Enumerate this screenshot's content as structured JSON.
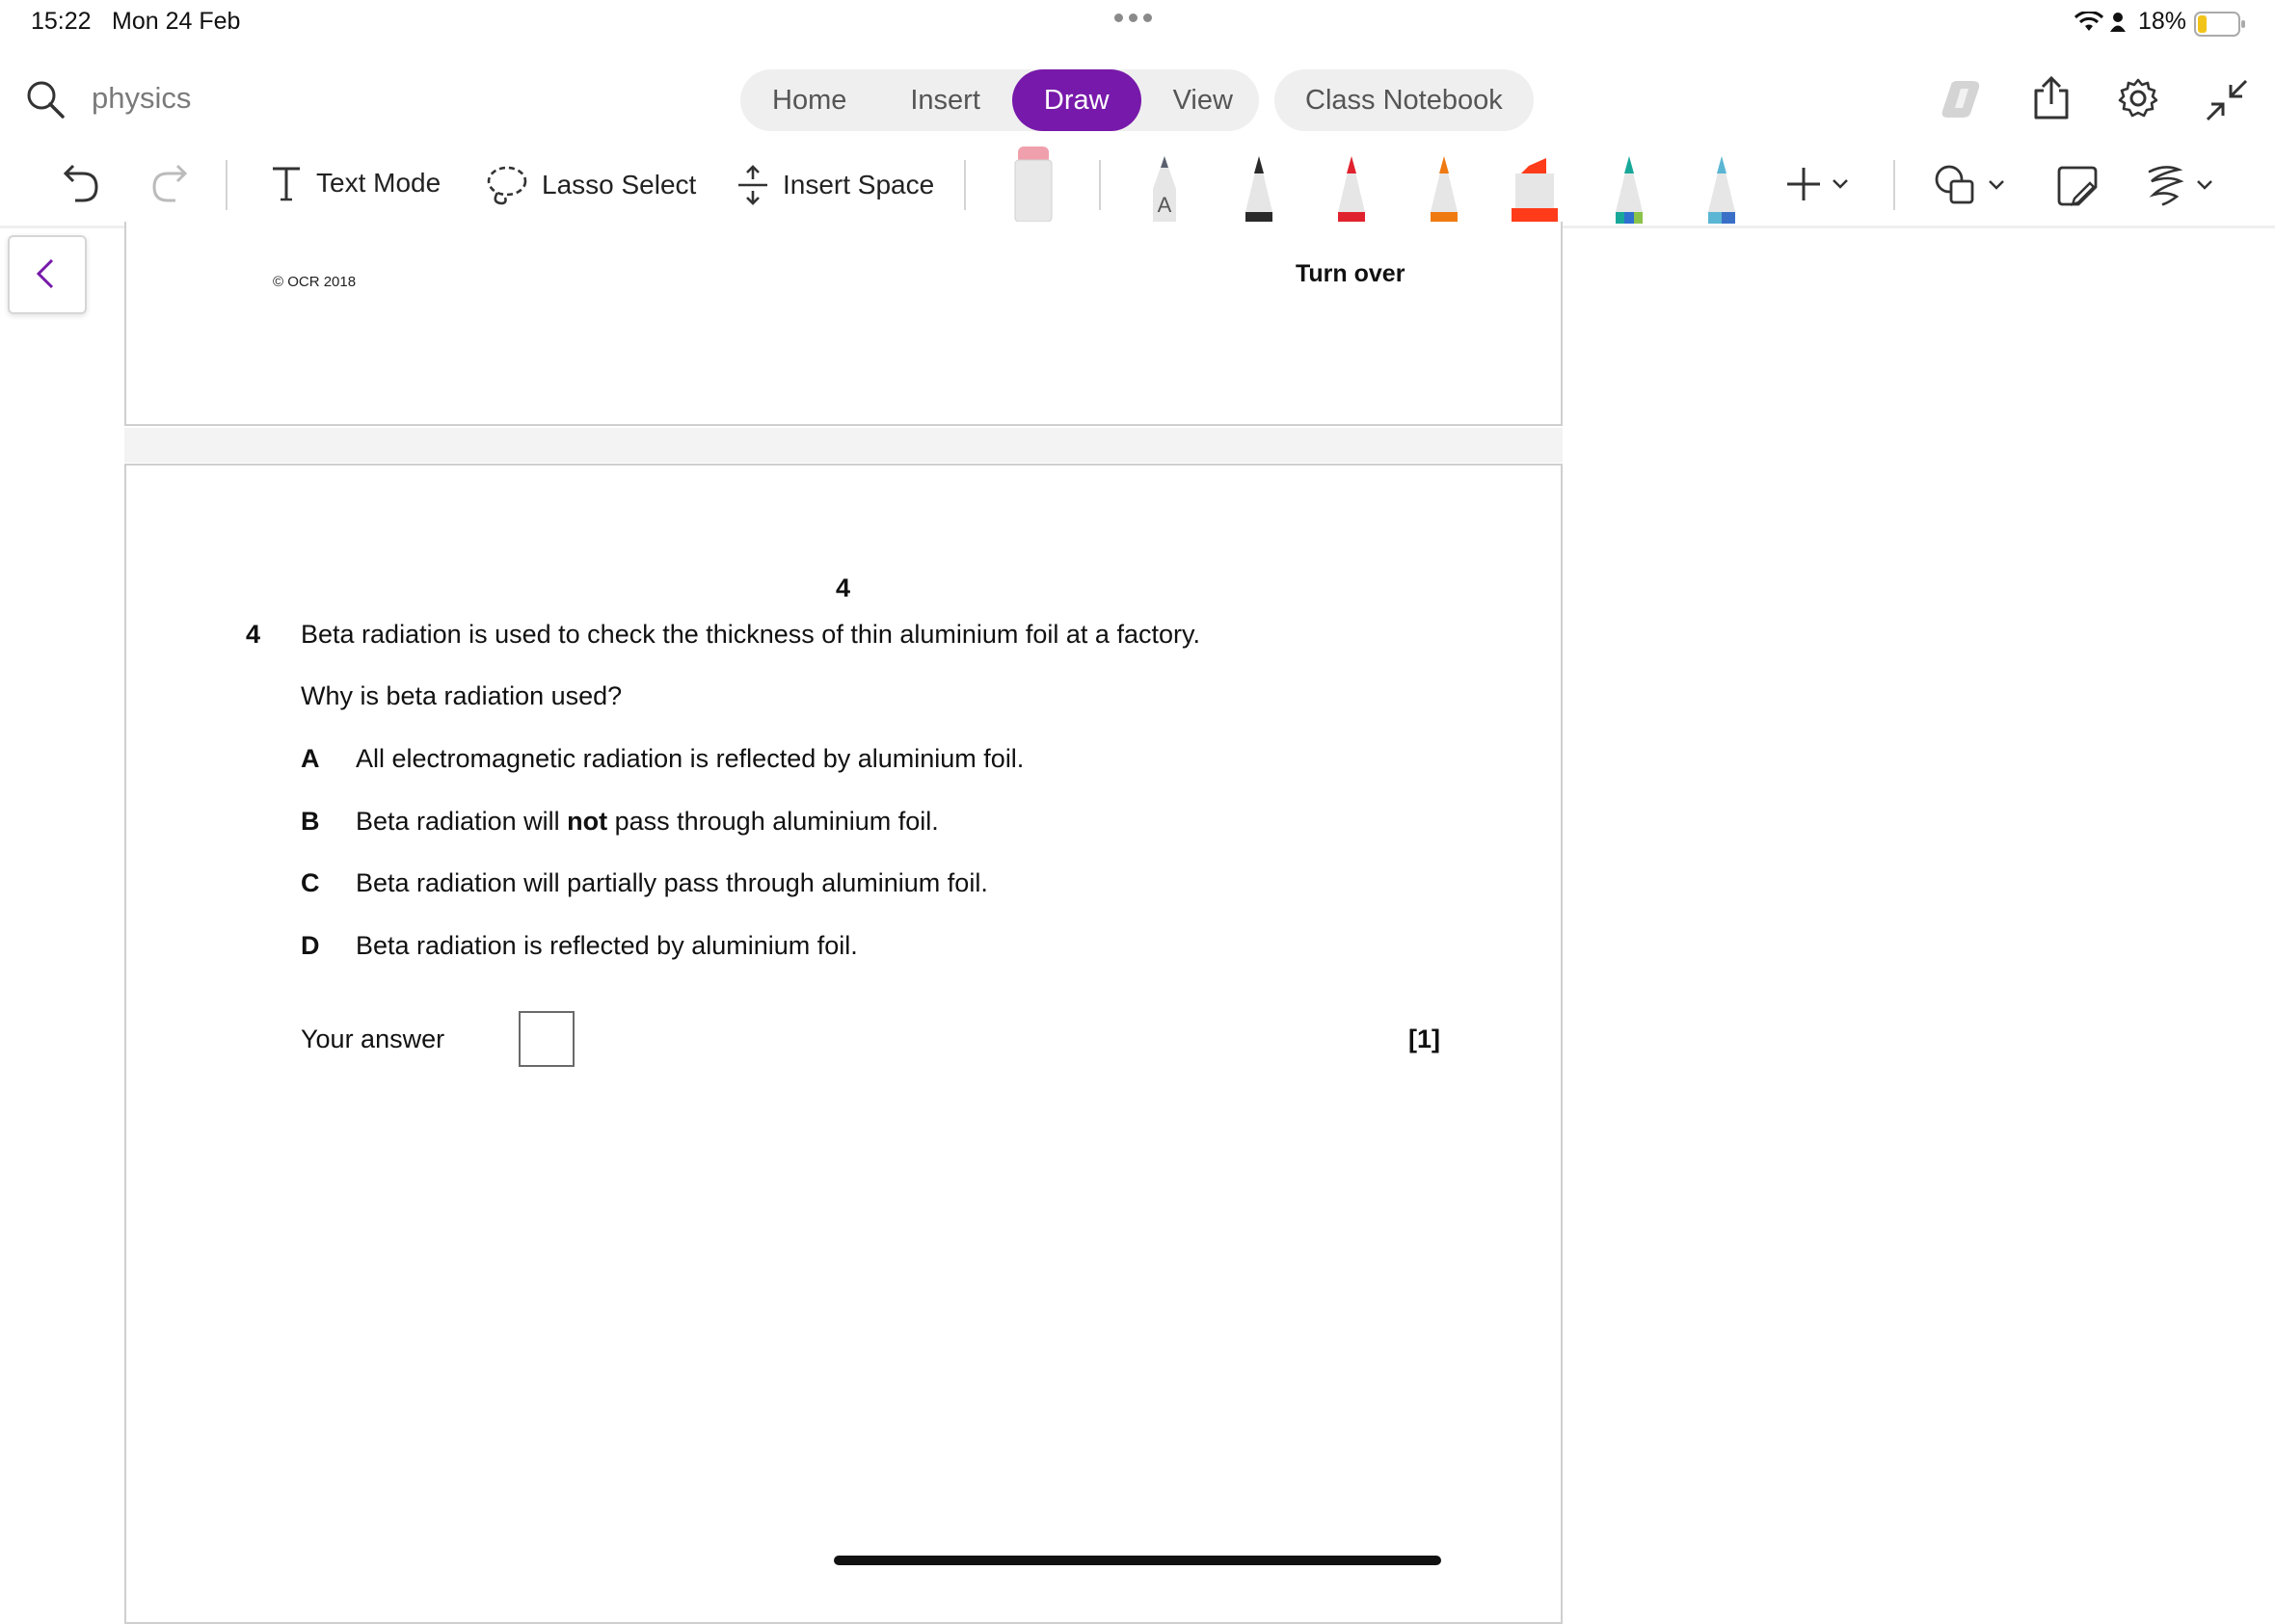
{
  "status_bar": {
    "time": "15:22",
    "date": "Mon 24 Feb",
    "battery": "18%"
  },
  "search": {
    "query": "physics"
  },
  "tabs": [
    {
      "label": "Home",
      "active": false
    },
    {
      "label": "Insert",
      "active": false
    },
    {
      "label": "Draw",
      "active": true
    },
    {
      "label": "View",
      "active": false
    }
  ],
  "class_notebook_label": "Class Notebook",
  "toolbar": {
    "text_mode": "Text Mode",
    "lasso_select": "Lasso Select",
    "insert_space": "Insert Space",
    "pen_colors": [
      "#5a6070",
      "#2a2a2a",
      "#e0222e",
      "#f07a12",
      "#ff3b1a",
      "#18a89a",
      "#5ab6d4"
    ]
  },
  "accent_color": "#7719aa",
  "document": {
    "copyright": "© OCR 2018",
    "turn_over": "Turn over",
    "page_number": "4",
    "question_number": "4",
    "question_text": "Beta radiation is used to check the thickness of thin aluminium foil at a factory.",
    "prompt": "Why is beta radiation used?",
    "options": [
      {
        "letter": "A",
        "pre": "All electromagnetic radiation is reflected by aluminium foil.",
        "bold": "",
        "post": ""
      },
      {
        "letter": "B",
        "pre": "Beta radiation will ",
        "bold": "not",
        "post": " pass through aluminium foil."
      },
      {
        "letter": "C",
        "pre": "Beta radiation will partially pass through aluminium foil.",
        "bold": "",
        "post": ""
      },
      {
        "letter": "D",
        "pre": "Beta radiation is reflected by aluminium foil.",
        "bold": "",
        "post": ""
      }
    ],
    "your_answer_label": "Your answer",
    "marks": "[1]"
  }
}
